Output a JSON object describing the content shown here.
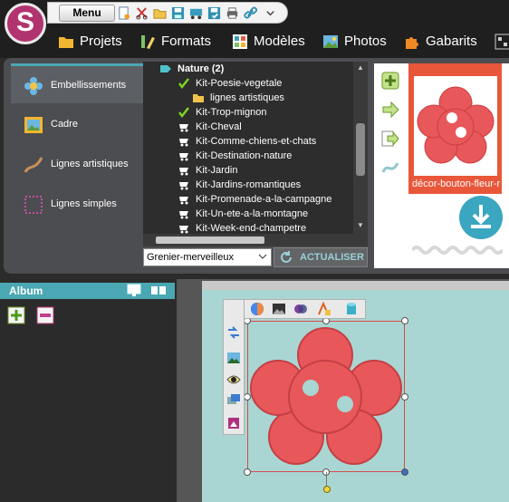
{
  "app": {
    "logo_letter": "S"
  },
  "quickbar": {
    "menu_label": "Menu",
    "icons": [
      "new-page-icon",
      "scissors-icon",
      "open-folder-icon",
      "save-icon",
      "cart-icon",
      "save-as-icon",
      "print-icon",
      "link-icon",
      "dropdown-arrow-icon"
    ]
  },
  "nav": {
    "items": [
      {
        "label": "Projets",
        "icon": "folder-icon"
      },
      {
        "label": "Formats",
        "icon": "ruler-pencil-icon"
      },
      {
        "label": "Modèles",
        "icon": "grid-icon"
      },
      {
        "label": "Photos",
        "icon": "photo-icon"
      },
      {
        "label": "Gabarits",
        "icon": "puzzle-icon"
      }
    ]
  },
  "sidebar": {
    "tabs": [
      {
        "label": "Embellissements",
        "icon": "flower-icon",
        "active": true
      },
      {
        "label": "Cadre",
        "icon": "frame-icon",
        "active": false
      },
      {
        "label": "Lignes artistiques",
        "icon": "art-line-icon",
        "active": false
      },
      {
        "label": "Lignes simples",
        "icon": "dotted-square-icon",
        "active": false
      }
    ]
  },
  "tree": {
    "root_label": "Nature (2)",
    "items": [
      {
        "label": "Kit-Poesie-vegetale",
        "state": "checked"
      },
      {
        "label": "lignes artistiques",
        "state": "folder"
      },
      {
        "label": "Kit-Trop-mignon",
        "state": "checked"
      },
      {
        "label": "Kit-Cheval",
        "state": "cart"
      },
      {
        "label": "Kit-Comme-chiens-et-chats",
        "state": "cart"
      },
      {
        "label": "Kit-Destination-nature",
        "state": "cart"
      },
      {
        "label": "Kit-Jardin",
        "state": "cart"
      },
      {
        "label": "Kit-Jardins-romantiques",
        "state": "cart"
      },
      {
        "label": "Kit-Promenade-a-la-campagne",
        "state": "cart"
      },
      {
        "label": "Kit-Un-ete-a-la-montagne",
        "state": "cart"
      },
      {
        "label": "Kit-Week-end-champetre",
        "state": "cart"
      }
    ]
  },
  "source": {
    "selected": "Grenier-merveilleux",
    "refresh_label": "ACTUALISER"
  },
  "preview": {
    "caption": "décor-bouton-fleur-r"
  },
  "album": {
    "title": "Album"
  },
  "colors": {
    "accent": "#4aa7b3",
    "brand": "#b1336f",
    "thumb_bg": "#e9573a",
    "button_red": "#e8575a",
    "page_bg": "#a9d6d2"
  }
}
